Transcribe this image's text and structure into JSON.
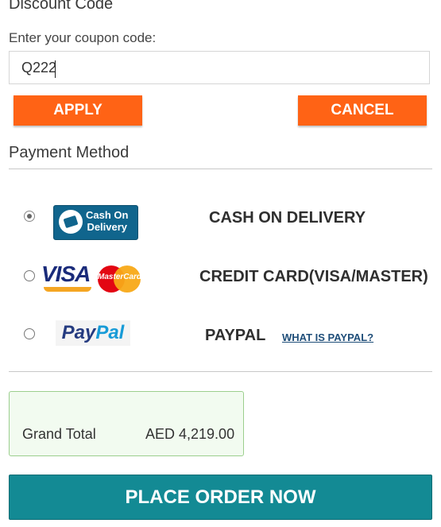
{
  "discount": {
    "title": "Discount Code",
    "coupon_label": "Enter your coupon code:",
    "coupon_value": "Q222",
    "apply_label": "APPLY",
    "cancel_label": "CANCEL"
  },
  "payment": {
    "title": "Payment Method",
    "options": [
      {
        "label": "CASH ON DELIVERY",
        "logo_text": [
          "Cash On",
          "Delivery"
        ],
        "selected": true,
        "icon": "cash-on-delivery-logo"
      },
      {
        "label": "CREDIT CARD(VISA/MASTER)",
        "logo_text": [
          "VISA",
          "MasterCard"
        ],
        "selected": false,
        "icon": "visa-mastercard-logo"
      },
      {
        "label": "PAYPAL",
        "logo_text": [
          "Pay",
          "Pal"
        ],
        "selected": false,
        "icon": "paypal-logo"
      }
    ],
    "paypal_info_link": "WHAT IS PAYPAL?"
  },
  "totals": {
    "grand_total_label": "Grand Total",
    "grand_total_value": "AED 4,219.00"
  },
  "place_order_label": "PLACE ORDER NOW",
  "colors": {
    "accent_orange": "#ff6315",
    "primary_teal": "#138a94",
    "total_box_bg": "#f2fbf0",
    "total_box_border": "#9ccf8e"
  }
}
